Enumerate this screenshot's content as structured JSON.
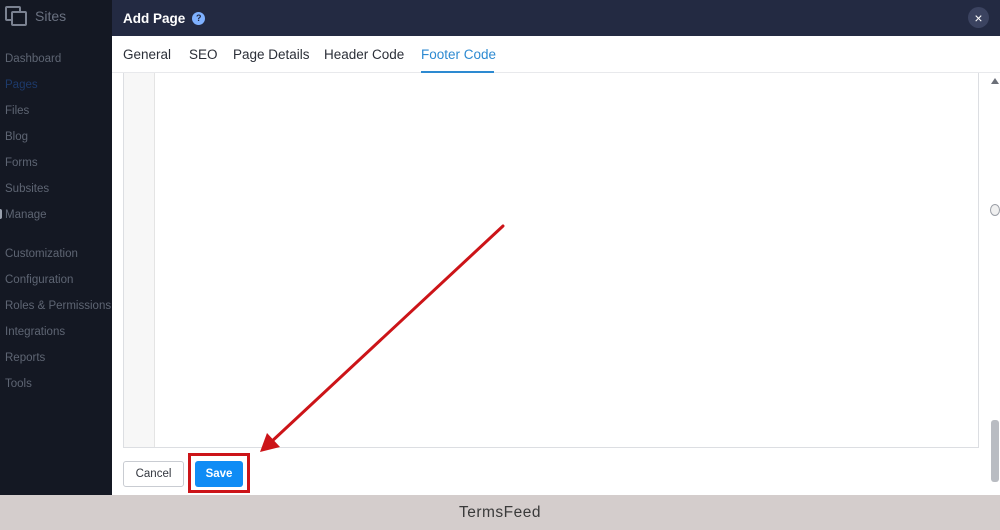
{
  "sidebar": {
    "brand": "Sites",
    "items": [
      {
        "label": "Dashboard"
      },
      {
        "label": "Pages"
      },
      {
        "label": "Files"
      },
      {
        "label": "Blog"
      },
      {
        "label": "Forms"
      },
      {
        "label": "Subsites"
      },
      {
        "label": "Manage"
      },
      {
        "label": "Customization"
      },
      {
        "label": "Configuration"
      },
      {
        "label": "Roles & Permissions"
      },
      {
        "label": "Integrations"
      },
      {
        "label": "Reports"
      },
      {
        "label": "Tools"
      }
    ],
    "active_item": "Pages"
  },
  "modal": {
    "title": "Add Page",
    "help_icon": "?",
    "close_icon": "×",
    "tabs": [
      {
        "label": "General"
      },
      {
        "label": "SEO"
      },
      {
        "label": "Page Details"
      },
      {
        "label": "Header Code"
      },
      {
        "label": "Footer Code"
      }
    ],
    "active_tab": "Footer Code",
    "editor_value": "",
    "cancel_label": "Cancel",
    "save_label": "Save"
  },
  "annotation": {
    "color": "#cc1418",
    "target": "save-button"
  },
  "footer": {
    "text": "TermsFeed"
  },
  "colors": {
    "header_bg": "#232a42",
    "accent": "#2d8ad1",
    "save_button": "#0f8cf5"
  }
}
